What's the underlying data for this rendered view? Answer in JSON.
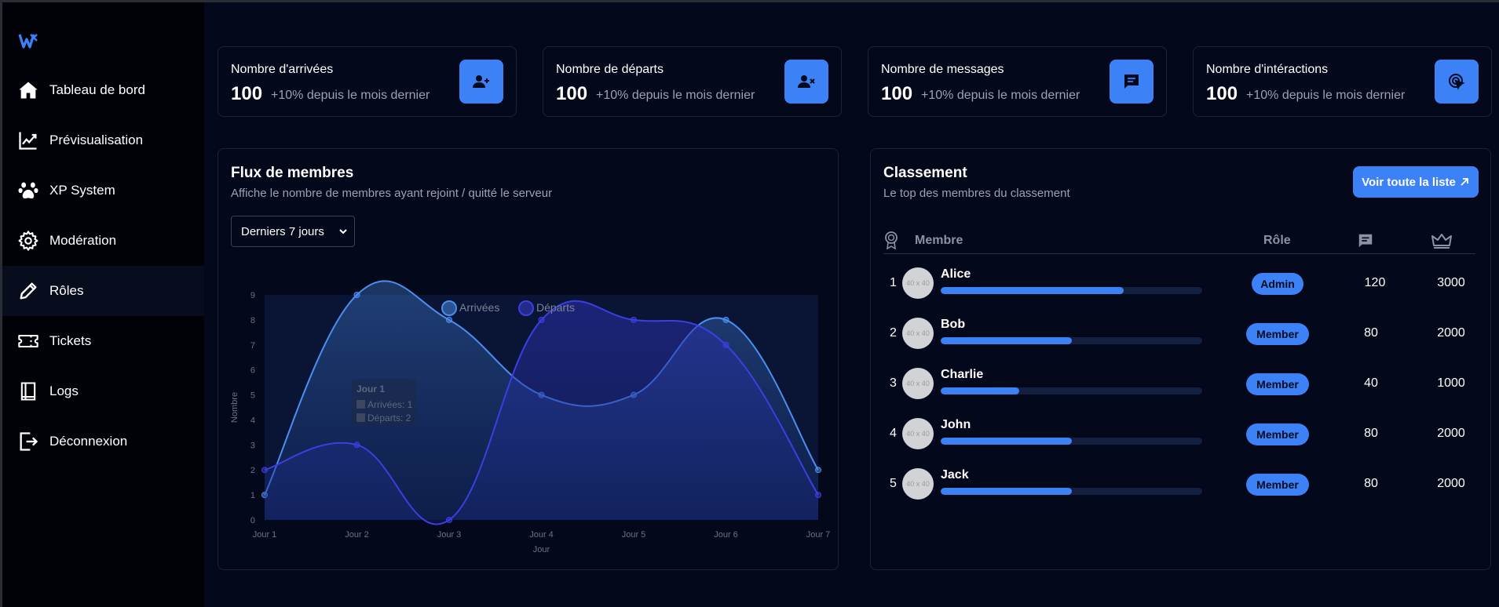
{
  "sidebar": {
    "items": [
      {
        "label": "Tableau de bord",
        "icon": "home-icon",
        "state": "active"
      },
      {
        "label": "Prévisualisation",
        "icon": "chart-line-icon",
        "state": ""
      },
      {
        "label": "XP System",
        "icon": "paw-icon",
        "state": ""
      },
      {
        "label": "Modération",
        "icon": "gear-icon",
        "state": ""
      },
      {
        "label": "Rôles",
        "icon": "pencil-icon",
        "state": "hover"
      },
      {
        "label": "Tickets",
        "icon": "ticket-icon",
        "state": ""
      },
      {
        "label": "Logs",
        "icon": "book-icon",
        "state": ""
      },
      {
        "label": "Déconnexion",
        "icon": "logout-icon",
        "state": ""
      }
    ]
  },
  "stats": [
    {
      "title": "Nombre d'arrivées",
      "value": "100",
      "delta": "+10% depuis le mois dernier",
      "icon": "user-plus-icon"
    },
    {
      "title": "Nombre de départs",
      "value": "100",
      "delta": "+10% depuis le mois dernier",
      "icon": "user-x-icon"
    },
    {
      "title": "Nombre de messages",
      "value": "100",
      "delta": "+10% depuis le mois dernier",
      "icon": "message-icon"
    },
    {
      "title": "Nombre d'intéractions",
      "value": "100",
      "delta": "+10% depuis le mois dernier",
      "icon": "click-icon"
    }
  ],
  "flux": {
    "title": "Flux de membres",
    "subtitle": "Affiche le nombre de membres ayant rejoint / quitté le serveur",
    "select_value": "Derniers 7 jours"
  },
  "chart_data": {
    "type": "area",
    "categories": [
      "Jour 1",
      "Jour 2",
      "Jour 3",
      "Jour 4",
      "Jour 5",
      "Jour 6",
      "Jour 7"
    ],
    "series": [
      {
        "name": "Arrivées",
        "values": [
          1,
          9,
          8,
          5,
          5,
          8,
          2
        ],
        "color": "#4a8ff0"
      },
      {
        "name": "Départs",
        "values": [
          2,
          3,
          0,
          8,
          8,
          7,
          1
        ],
        "color": "#3b3fe0"
      }
    ],
    "xlabel": "Jour",
    "ylabel": "Nombre",
    "ylim": [
      0,
      9
    ],
    "yticks": [
      "0",
      "1",
      "2",
      "3",
      "4",
      "5",
      "6",
      "7",
      "8",
      "9"
    ],
    "legend": "top-center",
    "tooltip": {
      "title": "Jour 1",
      "lines": [
        "Arrivées: 1",
        "Départs: 2"
      ]
    }
  },
  "classement": {
    "title": "Classement",
    "subtitle": "Le top des membres du classement",
    "button_label": "Voir toute la liste",
    "col_member": "Membre",
    "col_role": "Rôle",
    "avatar_placeholder": "40 x 40",
    "rows": [
      {
        "rank": "1",
        "name": "Alice",
        "progress": 0.7,
        "role": "Admin",
        "messages": "120",
        "xp": "3000"
      },
      {
        "rank": "2",
        "name": "Bob",
        "progress": 0.5,
        "role": "Member",
        "messages": "80",
        "xp": "2000"
      },
      {
        "rank": "3",
        "name": "Charlie",
        "progress": 0.3,
        "role": "Member",
        "messages": "40",
        "xp": "1000"
      },
      {
        "rank": "4",
        "name": "John",
        "progress": 0.5,
        "role": "Member",
        "messages": "80",
        "xp": "2000"
      },
      {
        "rank": "5",
        "name": "Jack",
        "progress": 0.5,
        "role": "Member",
        "messages": "80",
        "xp": "2000"
      }
    ]
  }
}
